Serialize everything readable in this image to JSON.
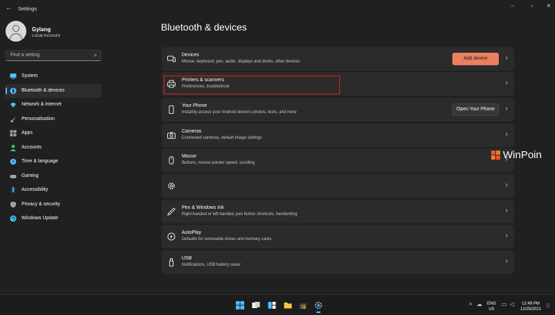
{
  "window": {
    "title": "Settings",
    "back_icon": "back-arrow-icon",
    "controls": [
      "minimize-icon",
      "maximize-icon",
      "close-icon"
    ]
  },
  "profile": {
    "name": "Gylang",
    "account_type": "Local Account"
  },
  "search": {
    "placeholder": "Find a setting",
    "icon": "search-icon"
  },
  "sidebar": {
    "items": [
      {
        "label": "System",
        "icon": "system-icon",
        "color": "#4cc2ff",
        "active": false
      },
      {
        "label": "Bluetooth & devices",
        "icon": "bluetooth-icon",
        "color": "#4cc2ff",
        "active": true
      },
      {
        "label": "Network & internet",
        "icon": "wifi-icon",
        "color": "#4cc2ff",
        "active": false
      },
      {
        "label": "Personalisation",
        "icon": "brush-icon",
        "color": "#e8a860",
        "active": false
      },
      {
        "label": "Apps",
        "icon": "apps-icon",
        "color": "#9aa4b2",
        "active": false
      },
      {
        "label": "Accounts",
        "icon": "person-icon",
        "color": "#3fbf7f",
        "active": false
      },
      {
        "label": "Time & language",
        "icon": "globe-clock-icon",
        "color": "#4cc2ff",
        "active": false
      },
      {
        "label": "Gaming",
        "icon": "gamepad-icon",
        "color": "#9aa4b2",
        "active": false
      },
      {
        "label": "Accessibility",
        "icon": "accessibility-icon",
        "color": "#4cc2ff",
        "active": false
      },
      {
        "label": "Privacy & security",
        "icon": "shield-icon",
        "color": "#9aa4b2",
        "active": false
      },
      {
        "label": "Windows Update",
        "icon": "update-icon",
        "color": "#4cc2ff",
        "active": false
      }
    ]
  },
  "main": {
    "title": "Bluetooth & devices",
    "cards": [
      {
        "title": "Devices",
        "subtitle": "Mouse, keyboard, pen, audio, displays and docks, other devices",
        "icon": "devices-icon",
        "button": "Add device",
        "button_style": "accent"
      },
      {
        "title": "Printers & scanners",
        "subtitle": "Preferences, troubleshoot",
        "icon": "printer-icon",
        "button": "",
        "highlighted": true
      },
      {
        "title": "Your Phone",
        "subtitle": "Instantly access your Android device's photos, texts, and more",
        "icon": "phone-icon",
        "button": "Open Your Phone",
        "button_style": "plain"
      },
      {
        "title": "Cameras",
        "subtitle": "Connected cameras, default image settings",
        "icon": "camera-icon",
        "button": ""
      },
      {
        "title": "Mouse",
        "subtitle": "Buttons, mouse pointer speed, scrolling",
        "icon": "mouse-icon",
        "button": ""
      },
      {
        "title": "",
        "subtitle": "",
        "icon": "gear-icon",
        "button": ""
      },
      {
        "title": "Pen & Windows Ink",
        "subtitle": "Right-handed or left-handed, pen button shortcuts, handwriting",
        "icon": "pen-icon",
        "button": ""
      },
      {
        "title": "AutoPlay",
        "subtitle": "Defaults for removable drives and memory cards",
        "icon": "autoplay-icon",
        "button": ""
      },
      {
        "title": "USB",
        "subtitle": "Notifications, USB battery saver",
        "icon": "usb-icon",
        "button": ""
      }
    ]
  },
  "watermark": {
    "text": "WinPoin"
  },
  "taskbar": {
    "icons": [
      "windows-start-icon",
      "task-view-icon",
      "widgets-icon",
      "file-explorer-icon",
      "store-icon",
      "settings-icon"
    ],
    "tray": {
      "lang_line1": "ENG",
      "lang_line2": "US",
      "time": "12:49 PM",
      "date": "12/25/2021"
    }
  }
}
